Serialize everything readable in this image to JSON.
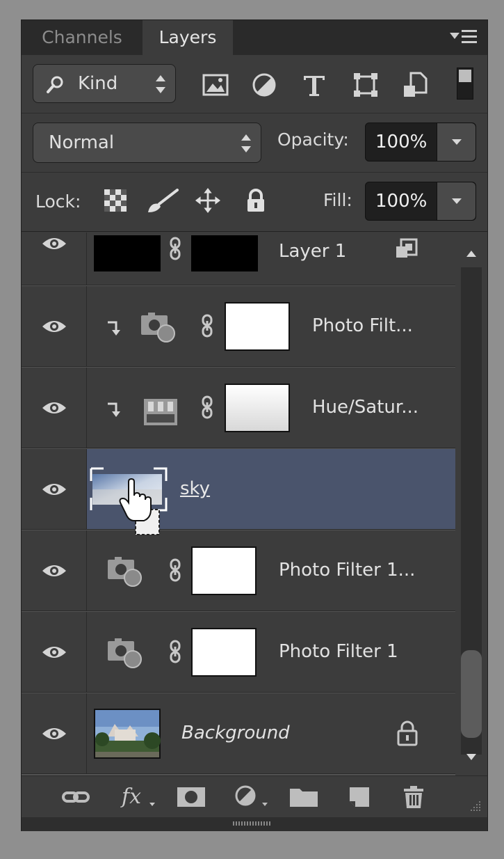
{
  "tabs": [
    {
      "label": "Channels",
      "active": false
    },
    {
      "label": "Layers",
      "active": true
    }
  ],
  "filter": {
    "kind_label": "Kind",
    "filter_icons": [
      "pixel-layer-filter-icon",
      "adjustment-layer-filter-icon",
      "type-layer-filter-icon",
      "shape-layer-filter-icon",
      "smart-object-filter-icon"
    ]
  },
  "blend": {
    "mode": "Normal",
    "opacity_label": "Opacity:",
    "opacity_value": "100%"
  },
  "lock": {
    "label": "Lock:",
    "icons": [
      "lock-transparent-pixels-icon",
      "lock-image-pixels-icon",
      "lock-position-icon",
      "lock-all-icon"
    ],
    "fill_label": "Fill:",
    "fill_value": "100%"
  },
  "layers": [
    {
      "name": "Layer 1",
      "type": "smart-object"
    },
    {
      "name": "Photo Filt...",
      "type": "adjustment-photo-filter",
      "clipped": true
    },
    {
      "name": "Hue/Satur...",
      "type": "adjustment-hue-saturation",
      "clipped": true
    },
    {
      "name": "sky",
      "type": "image",
      "selected": true,
      "dragging": true
    },
    {
      "name": "Photo Filter 1...",
      "type": "adjustment-photo-filter"
    },
    {
      "name": "Photo Filter 1",
      "type": "adjustment-photo-filter"
    },
    {
      "name": "Background",
      "type": "background",
      "locked": true
    }
  ],
  "footer_icons": [
    "link-layers-icon",
    "fx-icon",
    "add-mask-icon",
    "new-adjustment-layer-icon",
    "new-group-icon",
    "new-layer-icon",
    "delete-layer-icon"
  ],
  "footer_fx_label": "fx",
  "colors": {
    "panel_bg": "#3c3c3c",
    "selected_row": "#4a546c",
    "tabbar_bg": "#2a2a2a"
  }
}
